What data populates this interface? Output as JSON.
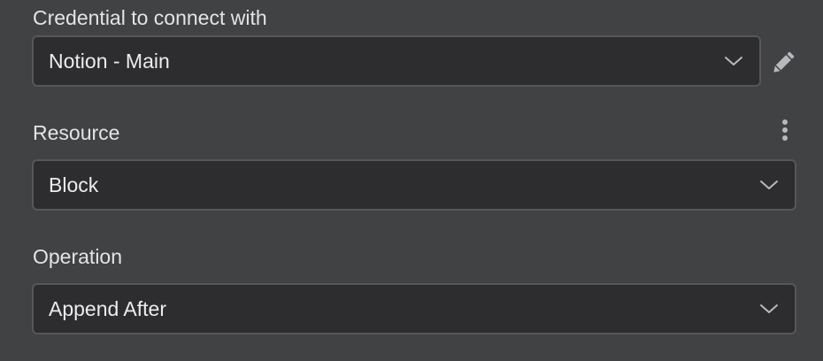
{
  "credential": {
    "label": "Credential to connect with",
    "value": "Notion - Main",
    "chevron_icon": "chevron-down-icon",
    "edit_icon": "pencil-icon"
  },
  "resource": {
    "label": "Resource",
    "value": "Block",
    "chevron_icon": "chevron-down-icon",
    "options_icon": "kebab-menu-icon"
  },
  "operation": {
    "label": "Operation",
    "value": "Append After",
    "chevron_icon": "chevron-down-icon"
  },
  "colors": {
    "panel_bg": "#414244",
    "field_bg": "#2d2d2f",
    "field_border": "#575759",
    "text": "#e4e4e6",
    "icon": "#b9b9bd"
  }
}
